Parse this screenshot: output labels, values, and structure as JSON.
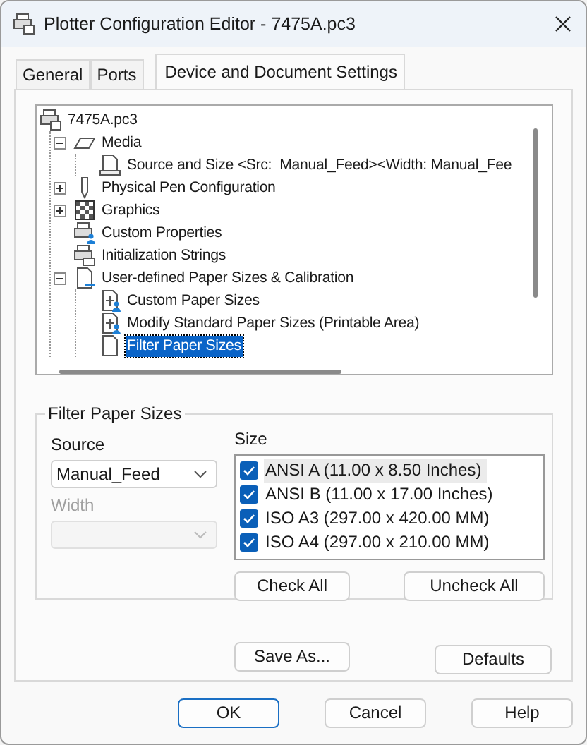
{
  "window": {
    "title": "Plotter Configuration Editor - 7475A.pc3"
  },
  "tabs": [
    {
      "label": "General",
      "selected": false
    },
    {
      "label": "Ports",
      "selected": false
    },
    {
      "label": "Device and Document Settings",
      "selected": true
    }
  ],
  "tree": [
    {
      "label": "7475A.pc3",
      "kind": "plotter",
      "selected": false,
      "children": [
        {
          "label": "Media",
          "kind": "media",
          "selected": false,
          "expanded": true,
          "children": [
            {
              "label": "Source and Size <Src:  Manual_Feed><Width: Manual_Fee",
              "kind": "paper-tray",
              "selected": false
            }
          ]
        },
        {
          "label": "Physical Pen Configuration",
          "kind": "pen",
          "selected": false,
          "expanded": false
        },
        {
          "label": "Graphics",
          "kind": "graphics",
          "selected": false,
          "expanded": false
        },
        {
          "label": "Custom Properties",
          "kind": "plotter-user",
          "selected": false
        },
        {
          "label": "Initialization Strings",
          "kind": "plotter-doc",
          "selected": false
        },
        {
          "label": "User-defined Paper Sizes & Calibration",
          "kind": "paper-folder",
          "selected": false,
          "expanded": true,
          "children": [
            {
              "label": "Custom Paper Sizes",
              "kind": "paper-user",
              "selected": false
            },
            {
              "label": "Modify Standard Paper Sizes (Printable Area)",
              "kind": "paper-user",
              "selected": false
            },
            {
              "label": "Filter Paper Sizes",
              "kind": "paper",
              "selected": true
            }
          ]
        }
      ]
    }
  ],
  "filter_group": {
    "title": "Filter Paper Sizes",
    "source_label": "Source",
    "source_value": "Manual_Feed",
    "width_label": "Width",
    "width_disabled": true,
    "size_label": "Size",
    "sizes": [
      {
        "label": "ANSI A (11.00 x 8.50 Inches)",
        "checked": true,
        "selected": true
      },
      {
        "label": "ANSI B (11.00 x 17.00 Inches)",
        "checked": true,
        "selected": false
      },
      {
        "label": "ISO A3 (297.00 x 420.00 MM)",
        "checked": true,
        "selected": false
      },
      {
        "label": "ISO A4 (297.00 x 210.00 MM)",
        "checked": true,
        "selected": false
      }
    ],
    "check_all": "Check All",
    "uncheck_all": "Uncheck All"
  },
  "save_as": "Save As...",
  "defaults": "Defaults",
  "buttons": [
    {
      "label": "OK",
      "default": true
    },
    {
      "label": "Cancel",
      "default": false
    },
    {
      "label": "Help",
      "default": false
    }
  ]
}
